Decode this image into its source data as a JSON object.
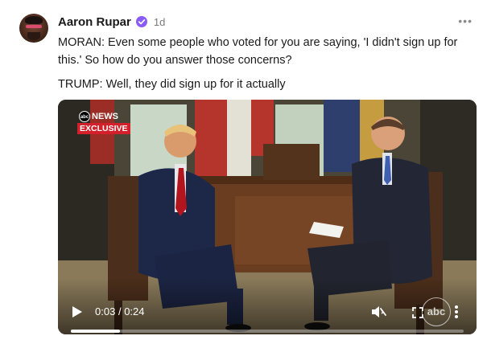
{
  "post": {
    "author": "Aaron Rupar",
    "time": "1d",
    "paragraphs": [
      "MORAN: Even some people who voted for you are saying, 'I didn't sign up for this.' So how do you answer those concerns?",
      "TRUMP: Well, they did sign up for it actually"
    ],
    "more_icon": "ellipsis-icon",
    "verified_icon": "verified-badge-icon",
    "accent_color": "#8a5cf6"
  },
  "video": {
    "badge": {
      "network": "NEWS",
      "label": "EXCLUSIVE",
      "logo_text": "abc"
    },
    "current_time": "0:03",
    "separator": "/",
    "duration": "0:24",
    "progress_fraction": 0.125,
    "watermark_text": "abc",
    "icons": {
      "play": "play-icon",
      "mute": "muted-speaker-icon",
      "fullscreen": "fullscreen-icon",
      "menu": "vertical-ellipsis-icon"
    },
    "badge_color": "#d3202a"
  }
}
